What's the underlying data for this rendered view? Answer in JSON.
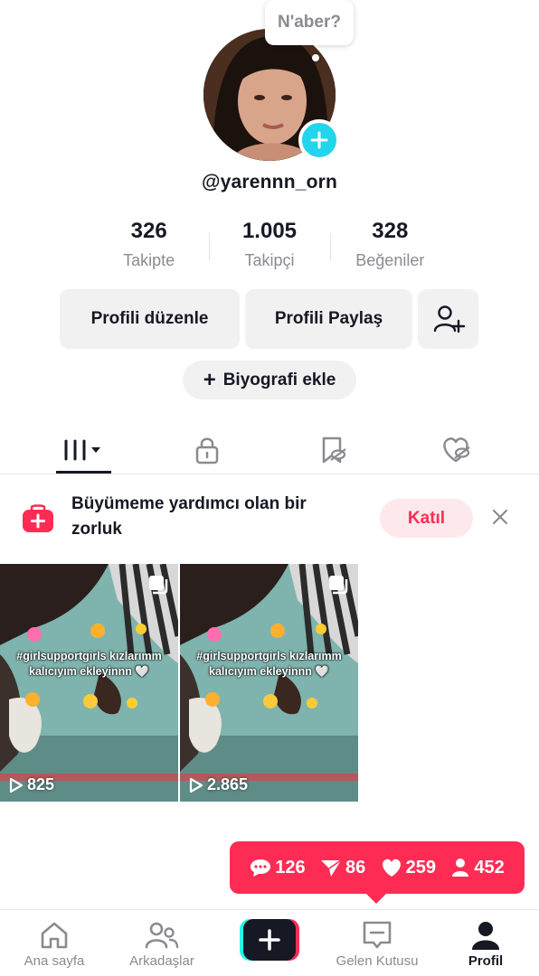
{
  "profile": {
    "bubble_text": "N'aber?",
    "username": "@yarennn_orn"
  },
  "stats": [
    {
      "value": "326",
      "label": "Takipte"
    },
    {
      "value": "1.005",
      "label": "Takipçi"
    },
    {
      "value": "328",
      "label": "Beğeniler"
    }
  ],
  "actions": {
    "edit_profile": "Profili düzenle",
    "share_profile": "Profili Paylaş",
    "add_bio": "Biyografi ekle"
  },
  "challenge": {
    "text": "Büyümeme yardımcı olan bir zorluk",
    "join_label": "Katıl"
  },
  "videos": [
    {
      "caption_line1": "#girlsupportgirls kızlarımm",
      "caption_line2": "kalıcıyım ekleyinnn 🤍",
      "views": "825"
    },
    {
      "caption_line1": "#girlsupportgirls kızlarımm",
      "caption_line2": "kalıcıyım ekleyinnn 🤍",
      "views": "2.865"
    }
  ],
  "notifications": {
    "comments": "126",
    "mentions": "86",
    "likes": "259",
    "followers": "452"
  },
  "nav": {
    "home": "Ana sayfa",
    "friends": "Arkadaşlar",
    "inbox": "Gelen Kutusu",
    "profile": "Profil"
  },
  "colors": {
    "accent": "#fe2c55",
    "add_badge": "#20d5ec",
    "muted_text": "#8a8b91"
  }
}
